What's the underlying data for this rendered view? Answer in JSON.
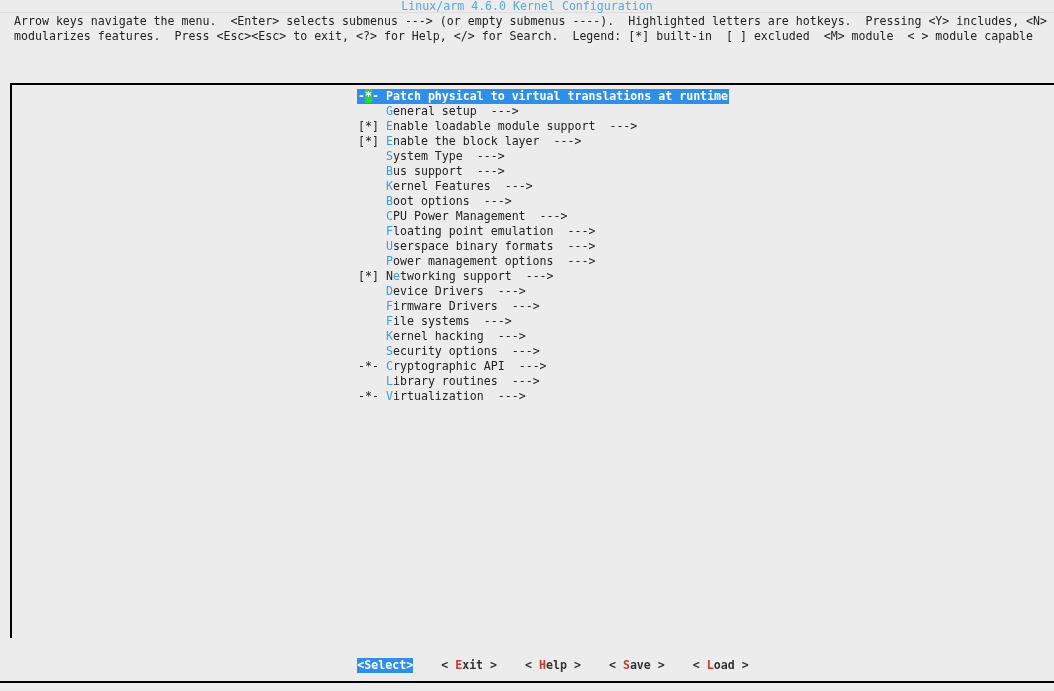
{
  "title": "Linux/arm 4.6.0 Kernel Configuration",
  "help_lines": [
    "Arrow keys navigate the menu.  <Enter> selects submenus ---> (or empty submenus ----).  Highlighted letters are hotkeys.  Pressing <Y> includes, <N>",
    "modularizes features.  Press <Esc><Esc> to exit, <?> for Help, </> for Search.  Legend: [*] built-in  [ ] excluded  <M> module  < > module capable"
  ],
  "menu": [
    {
      "state": "-*-",
      "label": {
        "key": "P",
        "after": "atch physical to virtual translations at runtime"
      },
      "selected": true
    },
    {
      "label": {
        "key": "G",
        "after": "eneral setup"
      },
      "arrow": "--->",
      "selected": false
    },
    {
      "state": "[*]",
      "label": {
        "key": "E",
        "after": "nable loadable module support"
      },
      "arrow": "--->",
      "selected": false
    },
    {
      "state": "[*]",
      "label": {
        "key": "E",
        "after": "nable the block layer"
      },
      "arrow": "--->",
      "selected": false
    },
    {
      "label": {
        "key": "S",
        "after": "ystem Type"
      },
      "arrow": "--->",
      "selected": false
    },
    {
      "label": {
        "key": "B",
        "after": "us support"
      },
      "arrow": "--->",
      "selected": false
    },
    {
      "label": {
        "key": "K",
        "after": "ernel Features"
      },
      "arrow": "--->",
      "selected": false
    },
    {
      "label": {
        "key": "B",
        "after": "oot options"
      },
      "arrow": "--->",
      "selected": false
    },
    {
      "label": {
        "key": "C",
        "after": "PU Power Management"
      },
      "arrow": "--->",
      "selected": false
    },
    {
      "label": {
        "key": "F",
        "after": "loating point emulation"
      },
      "arrow": "--->",
      "selected": false
    },
    {
      "label": {
        "key": "U",
        "after": "serspace binary formats"
      },
      "arrow": "--->",
      "selected": false
    },
    {
      "label": {
        "key": "P",
        "after": "ower management options"
      },
      "arrow": "--->",
      "selected": false
    },
    {
      "state": "[*]",
      "label": {
        "before": "N",
        "key": "e",
        "after": "tworking support"
      },
      "arrow": "--->",
      "selected": false
    },
    {
      "label": {
        "key": "D",
        "after": "evice Drivers"
      },
      "arrow": "--->",
      "selected": false
    },
    {
      "label": {
        "key": "F",
        "after": "irmware Drivers"
      },
      "arrow": "--->",
      "selected": false
    },
    {
      "label": {
        "key": "F",
        "after": "ile systems"
      },
      "arrow": "--->",
      "selected": false
    },
    {
      "label": {
        "key": "K",
        "after": "ernel hacking"
      },
      "arrow": "--->",
      "selected": false
    },
    {
      "label": {
        "key": "S",
        "after": "ecurity options"
      },
      "arrow": "--->",
      "selected": false
    },
    {
      "state": "-*-",
      "label": {
        "key": "C",
        "after": "ryptographic API"
      },
      "arrow": "--->",
      "selected": false
    },
    {
      "label": {
        "key": "L",
        "after": "ibrary routines"
      },
      "arrow": "--->",
      "selected": false
    },
    {
      "state": "-*-",
      "label": {
        "key": "V",
        "after": "irtualization"
      },
      "arrow": "--->",
      "selected": false
    }
  ],
  "buttons": [
    {
      "before": "<",
      "key": "S",
      "after": "elect>",
      "selected": true
    },
    {
      "before": "< ",
      "key": "E",
      "after": "xit >",
      "selected": false
    },
    {
      "before": "< ",
      "key": "H",
      "after": "elp >",
      "selected": false
    },
    {
      "before": "< ",
      "key": "S",
      "after": "ave >",
      "selected": false
    },
    {
      "before": "< ",
      "key": "L",
      "after": "oad >",
      "selected": false
    }
  ]
}
